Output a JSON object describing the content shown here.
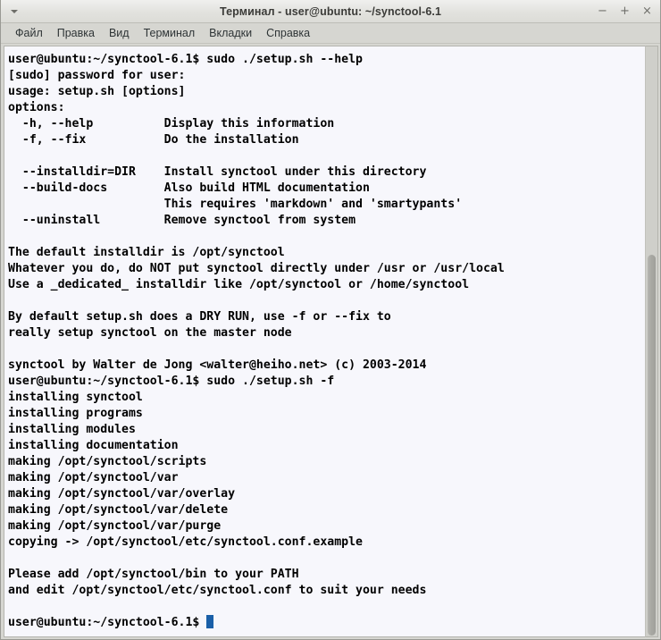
{
  "window": {
    "title": "Терминал - user@ubuntu: ~/synctool-6.1",
    "menu_arrow_icon": "chevron-down-icon",
    "buttons": {
      "minimize": "−",
      "maximize": "+",
      "close": "×"
    }
  },
  "menubar": {
    "items": [
      {
        "label": "Файл"
      },
      {
        "label": "Правка"
      },
      {
        "label": "Вид"
      },
      {
        "label": "Терминал"
      },
      {
        "label": "Вкладки"
      },
      {
        "label": "Справка"
      }
    ]
  },
  "terminal": {
    "background_color": "#f7f7fc",
    "foreground_color": "#000000",
    "cursor_color": "#1a5fa8",
    "prompt": "user@ubuntu:~/synctool-6.1$ ",
    "lines": [
      "user@ubuntu:~/synctool-6.1$ sudo ./setup.sh --help",
      "[sudo] password for user:",
      "usage: setup.sh [options]",
      "options:",
      "  -h, --help          Display this information",
      "  -f, --fix           Do the installation",
      "",
      "  --installdir=DIR    Install synctool under this directory",
      "  --build-docs        Also build HTML documentation",
      "                      This requires 'markdown' and 'smartypants'",
      "  --uninstall         Remove synctool from system",
      "",
      "The default installdir is /opt/synctool",
      "Whatever you do, do NOT put synctool directly under /usr or /usr/local",
      "Use a _dedicated_ installdir like /opt/synctool or /home/synctool",
      "",
      "By default setup.sh does a DRY RUN, use -f or --fix to",
      "really setup synctool on the master node",
      "",
      "synctool by Walter de Jong <walter@heiho.net> (c) 2003-2014",
      "user@ubuntu:~/synctool-6.1$ sudo ./setup.sh -f",
      "installing synctool",
      "installing programs",
      "installing modules",
      "installing documentation",
      "making /opt/synctool/scripts",
      "making /opt/synctool/var",
      "making /opt/synctool/var/overlay",
      "making /opt/synctool/var/delete",
      "making /opt/synctool/var/purge",
      "copying -> /opt/synctool/etc/synctool.conf.example",
      "",
      "Please add /opt/synctool/bin to your PATH",
      "and edit /opt/synctool/etc/synctool.conf to suit your needs",
      ""
    ],
    "last_prompt": "user@ubuntu:~/synctool-6.1$ "
  },
  "scrollbar": {
    "orientation": "vertical",
    "thumb_at_bottom": true
  }
}
